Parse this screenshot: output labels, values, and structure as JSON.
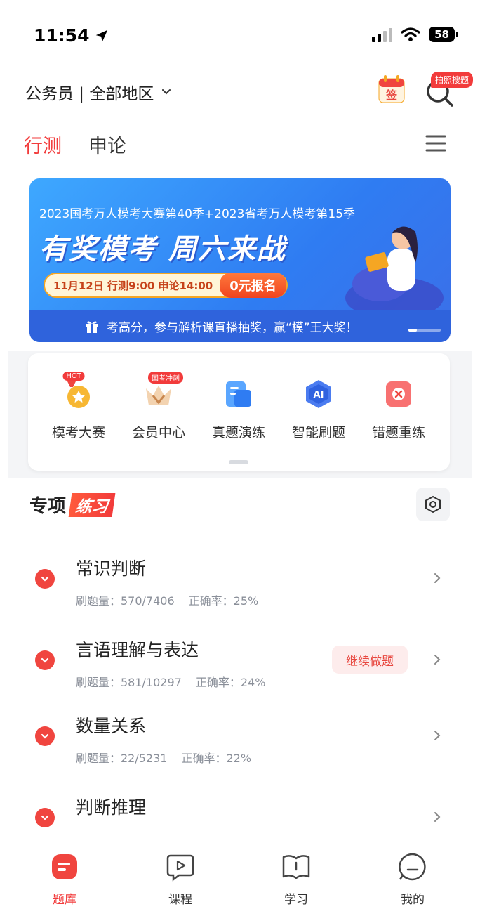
{
  "status_bar": {
    "time": "11:54",
    "battery": "58"
  },
  "header": {
    "region": "公务员 | 全部地区",
    "checkin_label": "签",
    "photo_search_badge": "拍照搜题"
  },
  "tabs": [
    {
      "label": "行测",
      "active": true
    },
    {
      "label": "申论",
      "active": false
    }
  ],
  "banner": {
    "top_text": "2023国考万人模考大赛第40季+2023省考万人模考第15季",
    "headline": "有奖模考  周六来战",
    "date_text": "11月12日  行测9:00  申论14:00",
    "register_label": "0元报名",
    "bottom_text": "考高分，参与解析课直播抽奖，赢“模”王大奖！"
  },
  "quick_actions": [
    {
      "label": "模考大赛",
      "icon": "trophy-icon",
      "tag": "HOT"
    },
    {
      "label": "会员中心",
      "icon": "crown-icon",
      "tag": "国考冲刺"
    },
    {
      "label": "真题演练",
      "icon": "document-icon",
      "tag": ""
    },
    {
      "label": "智能刷题",
      "icon": "ai-icon",
      "tag": ""
    },
    {
      "label": "错题重练",
      "icon": "wrong-question-icon",
      "tag": ""
    }
  ],
  "section": {
    "title_1": "专项",
    "title_2": "练习"
  },
  "categories": [
    {
      "name": "常识判断",
      "count_label": "刷题量：570/7406",
      "accuracy_label": "正确率：25%",
      "continue_label": ""
    },
    {
      "name": "言语理解与表达",
      "count_label": "刷题量：581/10297",
      "accuracy_label": "正确率：24%",
      "continue_label": "继续做题"
    },
    {
      "name": "数量关系",
      "count_label": "刷题量：22/5231",
      "accuracy_label": "正确率：22%",
      "continue_label": ""
    },
    {
      "name": "判断推理",
      "count_label": "",
      "accuracy_label": "",
      "continue_label": ""
    }
  ],
  "bottom_nav": [
    {
      "label": "题库",
      "icon": "question-bank-icon",
      "active": true
    },
    {
      "label": "课程",
      "icon": "play-icon",
      "active": false
    },
    {
      "label": "学习",
      "icon": "book-icon",
      "active": false
    },
    {
      "label": "我的",
      "icon": "profile-icon",
      "active": false
    }
  ],
  "colors": {
    "accent": "#f23b3b",
    "banner_blue": "#2f7cf2"
  }
}
